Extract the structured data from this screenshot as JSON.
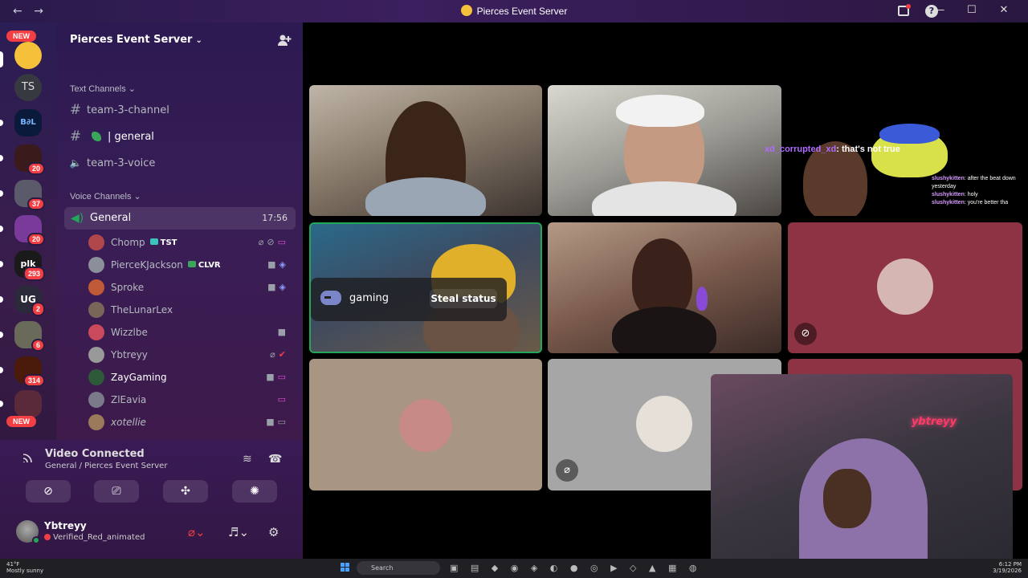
{
  "window": {
    "title": "Pierces Event Server",
    "back_icon": "←",
    "forward_icon": "→",
    "help_icon": "?",
    "minimize_icon": "—",
    "maximize_icon": "☐",
    "close_icon": "✕"
  },
  "guilds": {
    "new_top": "NEW",
    "new_bottom": "NEW",
    "items": [
      {
        "abbr": "TS",
        "badge": ""
      },
      {
        "abbr": "B∂L",
        "badge": ""
      },
      {
        "abbr": "",
        "badge": "20"
      },
      {
        "abbr": "",
        "badge": "37"
      },
      {
        "abbr": "",
        "badge": "20"
      },
      {
        "abbr": "plk",
        "badge": "293"
      },
      {
        "abbr": "UG",
        "badge": "2"
      },
      {
        "abbr": "",
        "badge": "6"
      },
      {
        "abbr": "",
        "badge": "314"
      },
      {
        "abbr": "",
        "badge": ""
      }
    ]
  },
  "channels": {
    "server_name": "Pierces Event Server",
    "server_caret": "⌄",
    "text_category": "Text Channels ⌄",
    "voice_category": "Voice Channels ⌄",
    "text": [
      {
        "name": "team-3-channel",
        "icon": "#"
      },
      {
        "name": "| general",
        "icon": "#"
      },
      {
        "name": "team-3-voice",
        "icon": "🔈"
      }
    ],
    "voice_channel": {
      "name": "General",
      "elapsed": "17:56"
    },
    "members": [
      {
        "name": "Chomp",
        "tag": "TST",
        "color": "#b0474a"
      },
      {
        "name": "PierceKJackson",
        "tag": "CLVR",
        "color": "#8a8f99"
      },
      {
        "name": "Sproke",
        "tag": "",
        "color": "#c05a38"
      },
      {
        "name": "TheLunarLex",
        "tag": "",
        "color": "#7a6658"
      },
      {
        "name": "Wizzlbe",
        "tag": "",
        "color": "#c94a5a"
      },
      {
        "name": "Ybtreyy",
        "tag": "",
        "color": "#999"
      },
      {
        "name": "ZayGaming",
        "tag": "",
        "color": "#2e5a3a"
      },
      {
        "name": "ZlEavia",
        "tag": "",
        "color": "#7a7a8a"
      },
      {
        "name": "xotellie",
        "tag": "",
        "color": "#9a7a5a"
      }
    ]
  },
  "voice_panel": {
    "status": "Video Connected",
    "location": "General / Pierces Event Server",
    "user_name": "Ybtreyy",
    "user_status": "Verified_Red_animated"
  },
  "stage": {
    "chat_overlay_user": "xd_corrupted_xd",
    "chat_overlay_msg": ": that's not true",
    "chat_lines": [
      {
        "user": "slushykitten",
        "msg": ": after the beat down yesterday"
      },
      {
        "user": "slushykitten",
        "msg": ": holy"
      },
      {
        "user": "slushykitten",
        "msg": ": you're better tha"
      }
    ],
    "activity_label": "gaming",
    "steal_button": "Steal status"
  },
  "taskbar": {
    "weather_temp": "41°F",
    "weather_desc": "Mostly sunny",
    "search_placeholder": "Search",
    "time": "6:12 PM",
    "date": "3/19/2026"
  }
}
